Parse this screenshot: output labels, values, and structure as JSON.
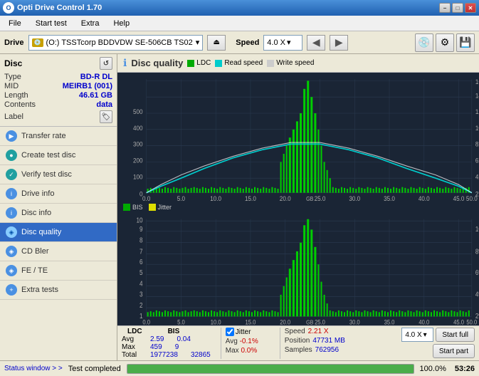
{
  "titleBar": {
    "title": "Opti Drive Control 1.70",
    "minimize": "−",
    "maximize": "□",
    "close": "✕"
  },
  "menuBar": {
    "items": [
      "File",
      "Start test",
      "Extra",
      "Help"
    ]
  },
  "driveBar": {
    "label": "Drive",
    "driveValue": "(O:)  TSSTcorp BDDVDW SE-506CB TS02",
    "speedLabel": "Speed",
    "speedValue": "4.0 X"
  },
  "discPanel": {
    "title": "Disc",
    "type_label": "Type",
    "type_value": "BD-R DL",
    "mid_label": "MID",
    "mid_value": "MEIRB1 (001)",
    "length_label": "Length",
    "length_value": "46.61 GB",
    "contents_label": "Contents",
    "contents_value": "data",
    "label_label": "Label"
  },
  "sidebarNav": [
    {
      "id": "transfer-rate",
      "label": "Transfer rate",
      "icon": "▶"
    },
    {
      "id": "create-test-disc",
      "label": "Create test disc",
      "icon": "●"
    },
    {
      "id": "verify-test-disc",
      "label": "Verify test disc",
      "icon": "✓"
    },
    {
      "id": "drive-info",
      "label": "Drive info",
      "icon": "i"
    },
    {
      "id": "disc-info",
      "label": "Disc info",
      "icon": "i"
    },
    {
      "id": "disc-quality",
      "label": "Disc quality",
      "icon": "◈",
      "active": true
    },
    {
      "id": "cd-bler",
      "label": "CD Bler",
      "icon": "◈"
    },
    {
      "id": "fe-te",
      "label": "FE / TE",
      "icon": "◈"
    },
    {
      "id": "extra-tests",
      "label": "Extra tests",
      "icon": "+"
    }
  ],
  "chartHeader": {
    "title": "Disc quality",
    "legend": [
      {
        "label": "LDC",
        "color": "#00aa00"
      },
      {
        "label": "Read speed",
        "color": "#00dddd"
      },
      {
        "label": "Write speed",
        "color": "#ffffff"
      }
    ],
    "legend2": [
      {
        "label": "BIS",
        "color": "#00aa00"
      },
      {
        "label": "Jitter",
        "color": "#eeee00"
      }
    ]
  },
  "stats": {
    "headers": [
      "LDC",
      "BIS"
    ],
    "avg_label": "Avg",
    "avg_ldc": "2.59",
    "avg_bis": "0.04",
    "avg_jitter": "-0.1%",
    "max_label": "Max",
    "max_ldc": "459",
    "max_bis": "9",
    "max_jitter": "0.0%",
    "total_label": "Total",
    "total_ldc": "1977238",
    "total_bis": "32865",
    "speed_label": "Speed",
    "speed_value": "2.21 X",
    "speed_combo": "4.0 X",
    "pos_label": "Position",
    "pos_value": "47731 MB",
    "samples_label": "Samples",
    "samples_value": "762956",
    "jitter_label": "Jitter",
    "start_full": "Start full",
    "start_part": "Start part"
  },
  "statusBar": {
    "status_window": "Status window > >",
    "test_completed": "Test completed",
    "progress": 100,
    "time": "53:26"
  }
}
